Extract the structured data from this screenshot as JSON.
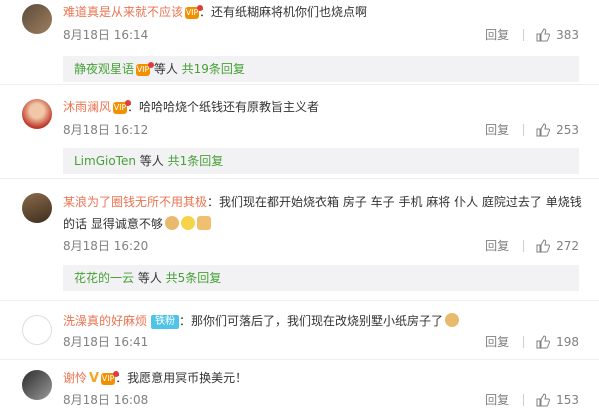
{
  "comments": [
    {
      "user": "难道真是从来就不应该",
      "text": "：还有纸糊麻将机你们也烧点啊",
      "time": "8月18日 16:14",
      "reply_label": "回复",
      "likes": "383",
      "sub": {
        "name": "静夜观星语",
        "mid": " 等人 ",
        "count": "共19条回复"
      }
    },
    {
      "user": "沐雨澜风",
      "text": "：哈哈哈烧个纸钱还有原教旨主义者",
      "time": "8月18日 16:12",
      "reply_label": "回复",
      "likes": "253",
      "sub": {
        "name": "LimGioTen",
        "mid": " 等人 ",
        "count": "共1条回复"
      }
    },
    {
      "user": "某浪为了圈钱无所不用其极",
      "text_line1": "：我们现在都开始烧衣箱 房子 车子 手机 麻将 仆人 庭院过去了 单烧钱",
      "text_line2": "的话 显得诚意不够",
      "time": "8月18日 16:20",
      "reply_label": "回复",
      "likes": "272",
      "sub": {
        "name": "花花的一云",
        "mid": " 等人 ",
        "count": "共5条回复"
      }
    },
    {
      "user": "洗澡真的好麻烦",
      "fans_label": "铁粉",
      "text": "：那你们可落后了，我们现在改烧别墅小纸房子了",
      "time": "8月18日 16:41",
      "reply_label": "回复",
      "likes": "198"
    },
    {
      "user": "谢怜",
      "text": "：我愿意用冥币换美元！",
      "time": "8月18日 16:08",
      "reply_label": "回复",
      "likes": "153"
    }
  ],
  "colors": {
    "username": "#eb7350",
    "subname": "#46a135",
    "meta": "#808080",
    "subbg": "#f2f2f5"
  }
}
